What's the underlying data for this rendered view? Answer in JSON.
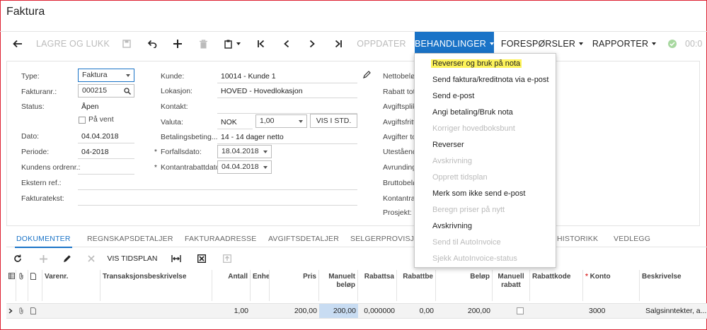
{
  "page": {
    "title": "Faktura"
  },
  "toolbar": {
    "save_close": "LAGRE OG LUKK",
    "refresh": "OPPDATER",
    "actions": "BEHANDLINGER",
    "inquiries": "FORESPØRSLER",
    "reports": "RAPPORTER",
    "time": "00:0",
    "colors": {
      "active_bg": "#1a73c7",
      "disabled": "#bbbbbb"
    }
  },
  "form": {
    "type_label": "Type:",
    "type_value": "Faktura",
    "refnr_label": "Fakturanr.:",
    "refnr_value": "000215",
    "status_label": "Status:",
    "status_value": "Åpen",
    "hold_label": "På vent",
    "date_label": "Dato:",
    "date_value": "04.04.2018",
    "period_label": "Periode:",
    "period_value": "04-2018",
    "custorder_label": "Kundens ordrenr.:",
    "extref_label": "Ekstern ref.:",
    "desc_label": "Fakturatekst:",
    "customer_label": "Kunde:",
    "customer_value": "10014 - Kunde 1",
    "location_label": "Lokasjon:",
    "location_value": "HOVED - Hovedlokasjon",
    "contact_label": "Kontakt:",
    "currency_label": "Valuta:",
    "currency_value": "NOK",
    "rate_value": "1,00",
    "view_base": "VIS I STD.",
    "terms_label": "Betalingsbeting...",
    "terms_value": "14 - 14 dager netto",
    "due_label": "Forfallsdato:",
    "due_value": "18.04.2018",
    "disc_label": "Kontantrabattdato:",
    "disc_value": "04.04.2018",
    "right_labels": [
      "Nettobeløp",
      "Rabatt tota",
      "Avgiftsplikt",
      "Avgiftsfritt",
      "Avgifter tot",
      "Utestående",
      "Avrunding",
      "Bruttobeløp",
      "Kontantrab",
      "Prosjekt:"
    ]
  },
  "tabs": [
    "DOKUMENTER",
    "REGNSKAPSDETALJER",
    "FAKTURAADRESSE",
    "AVGIFTSDETALJER",
    "SELGERPROVISJON",
    "HISTORIKK",
    "VEDLEGG"
  ],
  "grid_toolbar": {
    "schedule": "VIS TIDSPLAN"
  },
  "grid": {
    "headers": {
      "item": "Varenr.",
      "desc": "Transaksjonsbeskrivelse",
      "qty": "Antall",
      "uom": "Enhe",
      "price": "Pris",
      "manual_amt": "Manuelt beløp",
      "discpct": "Rabattsa",
      "discamt": "Rabattbe",
      "amount": "Beløp",
      "manual_disc": "Manuell rabatt",
      "disccode": "Rabattkode",
      "account": "Konto",
      "line_desc": "Beskrivelse"
    },
    "row": {
      "qty": "1,00",
      "price": "200,00",
      "manual_amt": "200,00",
      "discpct": "0,000000",
      "discamt": "0,00",
      "amount": "200,00",
      "account": "3000",
      "line_desc": "Salgsinntekter, a..."
    }
  },
  "menu": {
    "items": [
      "Reverser og bruk på nota",
      "Send faktura/kreditnota via e-post",
      "Send e-post",
      "Angi betaling/Bruk nota",
      "Korriger hovedboksbunt",
      "Reverser",
      "Avskrivning",
      "Opprett tidsplan",
      "Merk som ikke send e-post",
      "Beregn priser på nytt",
      "Avskrivning",
      "Send til AutoInvoice",
      "Sjekk AutoInvoice-status"
    ],
    "highlight_color": "#fdf35a"
  }
}
